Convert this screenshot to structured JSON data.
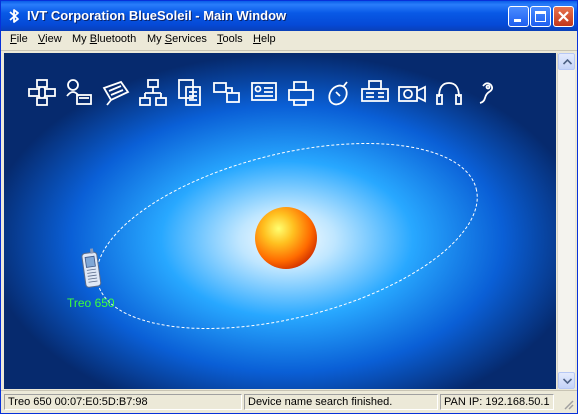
{
  "window": {
    "title": "IVT Corporation BlueSoleil - Main Window"
  },
  "menu": [
    {
      "pre": "",
      "u": "F",
      "post": "ile"
    },
    {
      "pre": "",
      "u": "V",
      "post": "iew"
    },
    {
      "pre": "My ",
      "u": "B",
      "post": "luetooth"
    },
    {
      "pre": "My ",
      "u": "S",
      "post": "ervices"
    },
    {
      "pre": "",
      "u": "T",
      "post": "ools"
    },
    {
      "pre": "",
      "u": "H",
      "post": "elp"
    }
  ],
  "services": [
    "network-access-icon",
    "personal-network-icon",
    "serial-port-icon",
    "lan-access-icon",
    "file-transfer-icon",
    "network-computers-icon",
    "business-card-icon",
    "printer-icon",
    "mouse-hid-icon",
    "fax-icon",
    "camera-icon",
    "headset-icon",
    "earpiece-icon"
  ],
  "device": {
    "name": "Treo 650",
    "label_color": "#3cff3c"
  },
  "colors": {
    "orbit": "#ffffff",
    "center_sphere": "#ff7a00",
    "background_outer": "#062a6e"
  },
  "status": {
    "device_info": "Treo 650  00:07:E0:5D:B7:98",
    "message": "Device name search finished.",
    "pan_ip": "PAN IP: 192.168.50.1"
  }
}
